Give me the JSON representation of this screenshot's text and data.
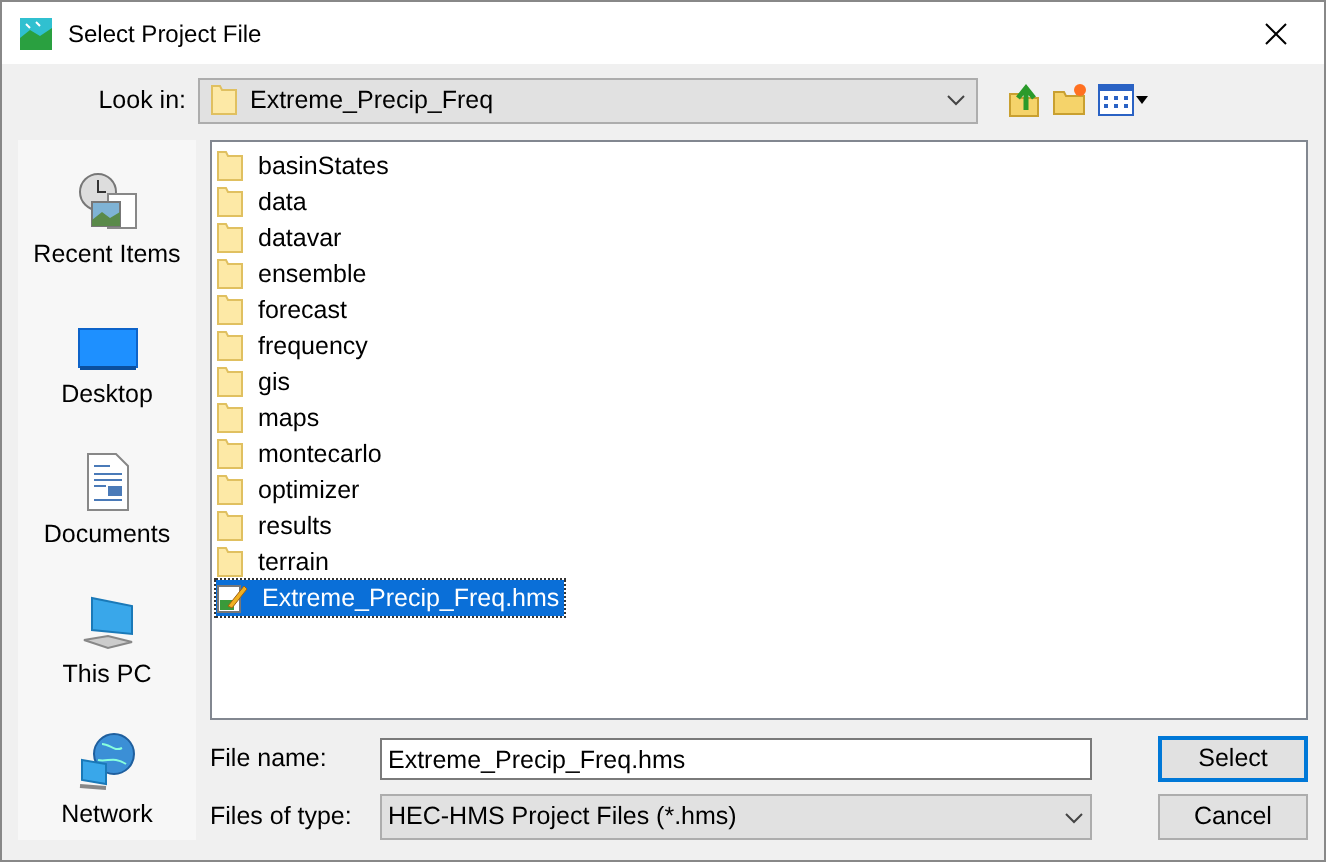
{
  "window": {
    "title": "Select Project File"
  },
  "look_in": {
    "label": "Look in:",
    "value": "Extreme_Precip_Freq"
  },
  "places": [
    {
      "kind": "recent",
      "label": "Recent Items"
    },
    {
      "kind": "desktop",
      "label": "Desktop"
    },
    {
      "kind": "documents",
      "label": "Documents"
    },
    {
      "kind": "pc",
      "label": "This PC"
    },
    {
      "kind": "network",
      "label": "Network"
    }
  ],
  "files": [
    {
      "kind": "folder",
      "name": "basinStates",
      "selected": false
    },
    {
      "kind": "folder",
      "name": "data",
      "selected": false
    },
    {
      "kind": "folder",
      "name": "datavar",
      "selected": false
    },
    {
      "kind": "folder",
      "name": "ensemble",
      "selected": false
    },
    {
      "kind": "folder",
      "name": "forecast",
      "selected": false
    },
    {
      "kind": "folder",
      "name": "frequency",
      "selected": false
    },
    {
      "kind": "folder",
      "name": "gis",
      "selected": false
    },
    {
      "kind": "folder",
      "name": "maps",
      "selected": false
    },
    {
      "kind": "folder",
      "name": "montecarlo",
      "selected": false
    },
    {
      "kind": "folder",
      "name": "optimizer",
      "selected": false
    },
    {
      "kind": "folder",
      "name": "results",
      "selected": false
    },
    {
      "kind": "folder",
      "name": "terrain",
      "selected": false
    },
    {
      "kind": "file",
      "name": "Extreme_Precip_Freq.hms",
      "selected": true
    }
  ],
  "file_name": {
    "label": "File name:",
    "value": "Extreme_Precip_Freq.hms"
  },
  "file_type": {
    "label": "Files of type:",
    "value": "HEC-HMS Project Files (*.hms)"
  },
  "buttons": [
    "Select",
    "Cancel"
  ]
}
